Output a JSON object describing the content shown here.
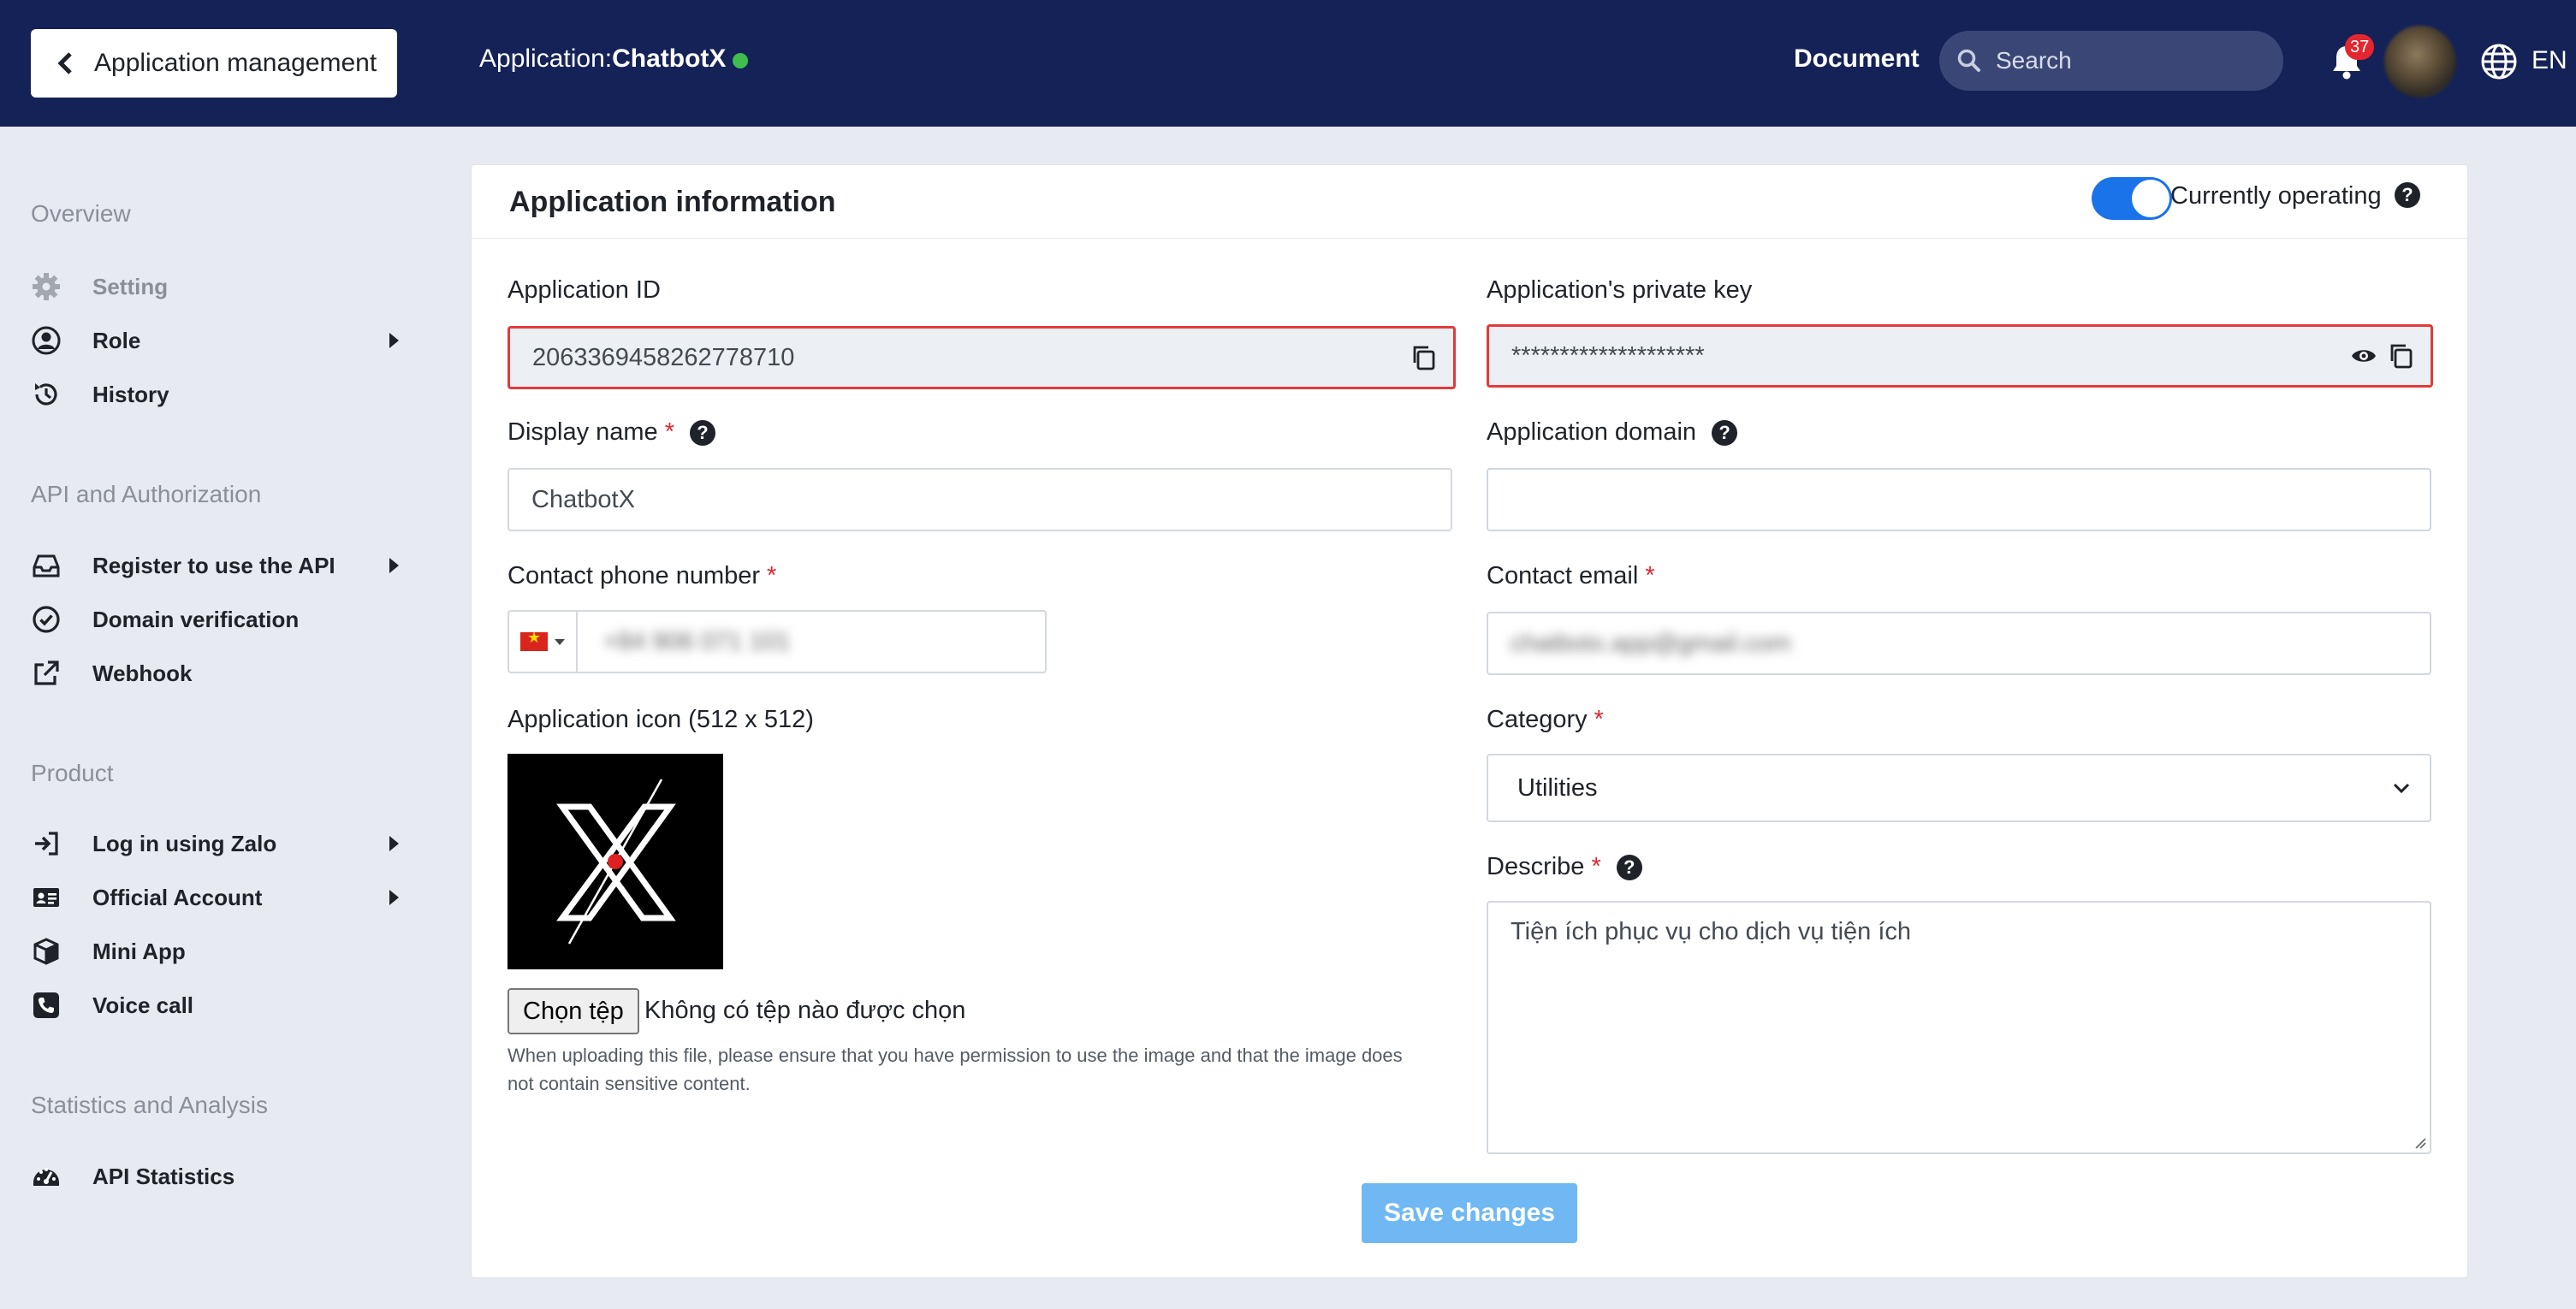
{
  "header": {
    "back_label": "Application management",
    "app_prefix": "Application:",
    "app_name": "ChatbotX",
    "document_label": "Document",
    "search_placeholder": "Search",
    "notification_count": "37",
    "language": "EN"
  },
  "sidebar": {
    "groups": [
      {
        "title": "Overview",
        "items": [
          {
            "label": "Setting",
            "icon": "gear-icon",
            "muted": true
          },
          {
            "label": "Role",
            "icon": "user-circle-icon",
            "has_submenu": true
          },
          {
            "label": "History",
            "icon": "history-icon"
          }
        ]
      },
      {
        "title": "API and Authorization",
        "items": [
          {
            "label": "Register to use the API",
            "icon": "inbox-icon",
            "has_submenu": true
          },
          {
            "label": "Domain verification",
            "icon": "check-circle-icon"
          },
          {
            "label": "Webhook",
            "icon": "external-link-icon"
          }
        ]
      },
      {
        "title": "Product",
        "items": [
          {
            "label": "Log in using Zalo",
            "icon": "sign-in-icon",
            "has_submenu": true
          },
          {
            "label": "Official Account",
            "icon": "id-card-icon",
            "has_submenu": true
          },
          {
            "label": "Mini App",
            "icon": "cube-icon"
          },
          {
            "label": "Voice call",
            "icon": "phone-icon"
          }
        ]
      },
      {
        "title": "Statistics and Analysis",
        "items": [
          {
            "label": "API Statistics",
            "icon": "speedometer-icon"
          }
        ]
      }
    ]
  },
  "card": {
    "title": "Application information",
    "status_label": "Currently operating",
    "status_on": true,
    "fields": {
      "app_id": {
        "label": "Application ID",
        "value": "2063369458262778710"
      },
      "private_key": {
        "label": "Application's private key",
        "value": "********************"
      },
      "display_name": {
        "label": "Display name",
        "value": "ChatbotX"
      },
      "app_domain": {
        "label": "Application domain",
        "value": ""
      },
      "phone": {
        "label": "Contact phone number",
        "value": "+84 906 071 101"
      },
      "email": {
        "label": "Contact email",
        "value": "chatbotx.app@gmail.com"
      },
      "icon": {
        "label": "Application icon (512 x 512)"
      },
      "category": {
        "label": "Category",
        "value": "Utilities"
      },
      "describe": {
        "label": "Describe",
        "value": "Tiện ích phục vụ cho dịch vụ tiện ích"
      }
    },
    "file": {
      "button_label": "Chọn tệp",
      "status": "Không có tệp nào được chọn",
      "note": "When uploading this file, please ensure that you have permission to use the image and that the image does not contain sensitive content."
    },
    "required_mark": "*",
    "help_mark": "?",
    "save_label": "Save changes"
  },
  "colors": {
    "header_bg": "#142257",
    "accent": "#1a73e8",
    "error_border": "#e23a3a",
    "save_button": "#6fb8f4",
    "status_dot": "#3fbe4f"
  }
}
